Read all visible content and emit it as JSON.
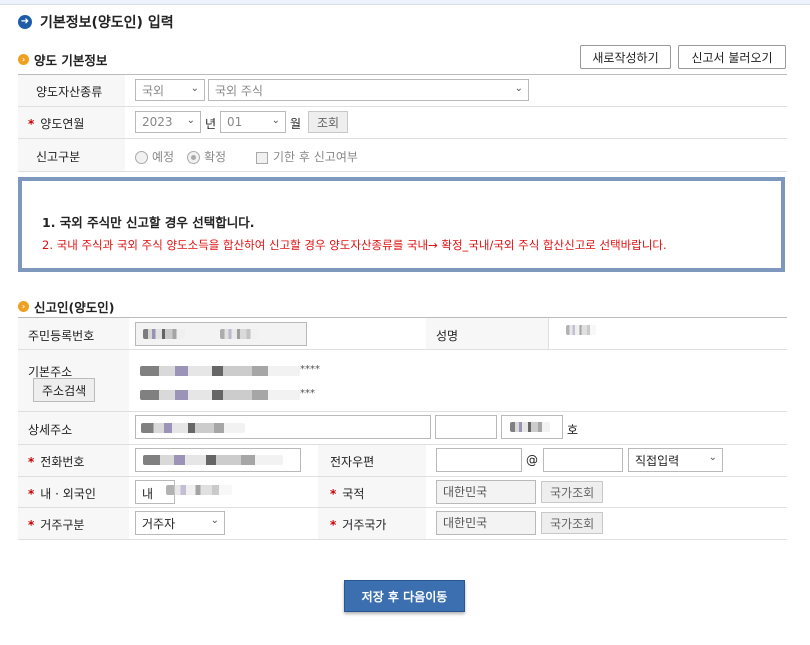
{
  "page": {
    "title": "기본정보(양도인) 입력"
  },
  "section1": {
    "title": "양도 기본정보",
    "new_button": "새로작성하기",
    "load_button": "신고서 불러오기",
    "asset_type_label": "양도자산종류",
    "asset_type_value1": "국외",
    "asset_type_value2": "국외 주식",
    "period_label": "양도연월",
    "year_value": "2023",
    "year_unit": "년",
    "month_value": "01",
    "month_unit": "월",
    "query_button": "조회",
    "report_type_label": "신고구분",
    "option_preliminary": "예정",
    "option_final": "확정",
    "option_late": "기한 후 신고여부"
  },
  "notice": {
    "line1": "1. 국외 주식만 신고할 경우 선택합니다.",
    "line2": "2. 국내 주식과 국외 주식 양도소득을 합산하여 신고할 경우 양도자산종류를 국내→ 확정_국내/국외 주식 합산신고로 선택바랍니다."
  },
  "section2": {
    "title": "신고인(양도인)",
    "rrn_label": "주민등록번호",
    "name_label": "성명",
    "address_label": "기본주소",
    "address_line1_suffix": "****",
    "address_line2_suffix": "***",
    "address_search_button": "주소검색",
    "detail_address_label": "상세주소",
    "ho_suffix": "호",
    "phone_label": "전화번호",
    "email_label": "전자우편",
    "email_at": "@",
    "email_domain_select": "직접입력",
    "nationality_type_label": "내 · 외국인",
    "nationality_type_value": "내",
    "country_label": "국적",
    "country_value": "대한민국",
    "country_query_button": "국가조회",
    "residence_label": "거주구분",
    "residence_value": "거주자",
    "residence_country_label": "거주국가",
    "residence_country_value": "대한민국",
    "residence_country_query_button": "국가조회"
  },
  "save_button": "저장 후 다음이동"
}
